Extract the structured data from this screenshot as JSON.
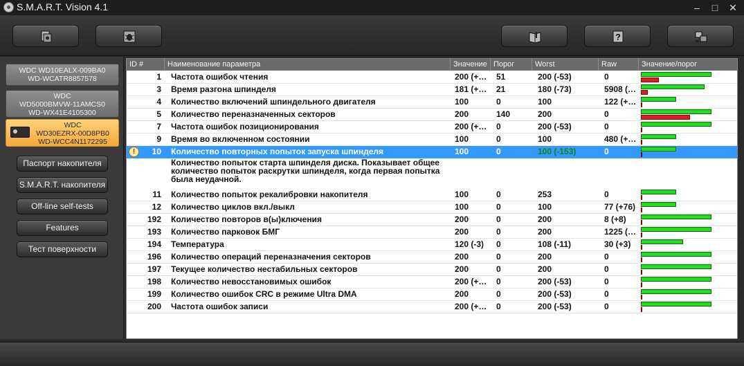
{
  "app": {
    "title": "S.M.A.R.T. Vision 4.1"
  },
  "window_buttons": {
    "minimize": "–",
    "maximize": "□",
    "close": "✕"
  },
  "toolbar": {
    "buttons": [
      {
        "icon": "disk-report-icon"
      },
      {
        "icon": "bug-icon"
      },
      {
        "icon": "book-icon"
      },
      {
        "icon": "help-icon"
      },
      {
        "icon": "exit-icon"
      }
    ]
  },
  "drives": [
    {
      "lines": [
        "WDC WD10EALX-009BA0",
        "WD-WCATR8857578"
      ],
      "selected": false
    },
    {
      "lines": [
        "WDC",
        "WD5000BMVW-11AMCS0",
        "WD-WX41E4105300"
      ],
      "selected": false
    },
    {
      "lines": [
        "WDC",
        "WD30EZRX-00D8PB0",
        "WD-WCC4N1172295"
      ],
      "selected": true
    }
  ],
  "sidebar_buttons": [
    "Паспорт накопителя",
    "S.M.A.R.T. накопителя",
    "Off-line self-tests",
    "Features",
    "Тест поверхности"
  ],
  "table": {
    "headers": [
      "ID #",
      "Наименование параметра",
      "Значение",
      "Порог",
      "Worst",
      "Raw",
      "Значение/порог"
    ],
    "rows": [
      {
        "id": "1",
        "name": "Частота ошибок чтения",
        "value": "200 (+…",
        "threshold": "51",
        "worst": "200 (-53)",
        "raw": "0",
        "green": 1.0,
        "red": 0.25
      },
      {
        "id": "3",
        "name": "Время разгона шпинделя",
        "value": "181 (+…",
        "threshold": "21",
        "worst": "180 (-73)",
        "raw": "5908 (…",
        "green": 0.9,
        "red": 0.1
      },
      {
        "id": "4",
        "name": "Количество включений шпиндельного двигателя",
        "value": "100",
        "threshold": "0",
        "worst": "100",
        "raw": "122 (+…",
        "green": 0.5,
        "red": 0.02
      },
      {
        "id": "5",
        "name": "Количество переназначенных секторов",
        "value": "200",
        "threshold": "140",
        "worst": "200",
        "raw": "0",
        "green": 1.0,
        "red": 0.7
      },
      {
        "id": "7",
        "name": "Частота ошибок позиционирования",
        "value": "200 (+…",
        "threshold": "0",
        "worst": "200 (-53)",
        "raw": "0",
        "green": 1.0,
        "red": 0.02
      },
      {
        "id": "9",
        "name": "Время во включенном состоянии",
        "value": "100",
        "threshold": "0",
        "worst": "100",
        "raw": "480 (+…",
        "green": 0.5,
        "red": 0.02
      },
      {
        "id": "10",
        "name": "Количество повторных попыток запуска шпинделя",
        "value": "100",
        "threshold": "0",
        "worst": "100 (-153)",
        "raw": "0",
        "green": 0.5,
        "red": 0.02,
        "selected": true
      },
      {
        "id": "11",
        "name": "Количество попыток рекалибровки накопителя",
        "value": "100",
        "threshold": "0",
        "worst": "253",
        "raw": "0",
        "green": 0.5,
        "red": 0.02
      },
      {
        "id": "12",
        "name": "Количество циклов вкл./выкл",
        "value": "100",
        "threshold": "0",
        "worst": "100",
        "raw": "77 (+76)",
        "green": 0.5,
        "red": 0.02
      },
      {
        "id": "192",
        "name": "Количество повторов в(ы)ключения",
        "value": "200",
        "threshold": "0",
        "worst": "200",
        "raw": "8 (+8)",
        "green": 1.0,
        "red": 0.02
      },
      {
        "id": "193",
        "name": "Количество парковок БМГ",
        "value": "200",
        "threshold": "0",
        "worst": "200",
        "raw": "1225 (…",
        "green": 1.0,
        "red": 0.02
      },
      {
        "id": "194",
        "name": "Температура",
        "value": "120 (-3)",
        "threshold": "0",
        "worst": "108 (-11)",
        "raw": "30 (+3)",
        "green": 0.6,
        "red": 0.02
      },
      {
        "id": "196",
        "name": "Количество операций переназначения секторов",
        "value": "200",
        "threshold": "0",
        "worst": "200",
        "raw": "0",
        "green": 1.0,
        "red": 0.02
      },
      {
        "id": "197",
        "name": "Текущее количество нестабильных секторов",
        "value": "200",
        "threshold": "0",
        "worst": "200",
        "raw": "0",
        "green": 1.0,
        "red": 0.02
      },
      {
        "id": "198",
        "name": "Количество невосстановимых ошибок",
        "value": "200 (+…",
        "threshold": "0",
        "worst": "200 (-53)",
        "raw": "0",
        "green": 1.0,
        "red": 0.02
      },
      {
        "id": "199",
        "name": "Количество ошибок CRC в режиме Ultra DMA",
        "value": "200",
        "threshold": "0",
        "worst": "200 (-53)",
        "raw": "0",
        "green": 1.0,
        "red": 0.02
      },
      {
        "id": "200",
        "name": "Частота ошибок записи",
        "value": "200 (+…",
        "threshold": "0",
        "worst": "200 (-53)",
        "raw": "0",
        "green": 1.0,
        "red": 0.02
      }
    ],
    "selected_description": [
      "Количество попыток старта шпинделя диска. Показывает общее",
      "количество попыток раскрутки шпинделя, когда первая попытка",
      "была неудачной."
    ]
  },
  "colors": {
    "selection": "#3399ff",
    "bar_green": "#22dd22",
    "bar_red": "#dd1f1f",
    "drive_selected": "#f2a83c"
  }
}
